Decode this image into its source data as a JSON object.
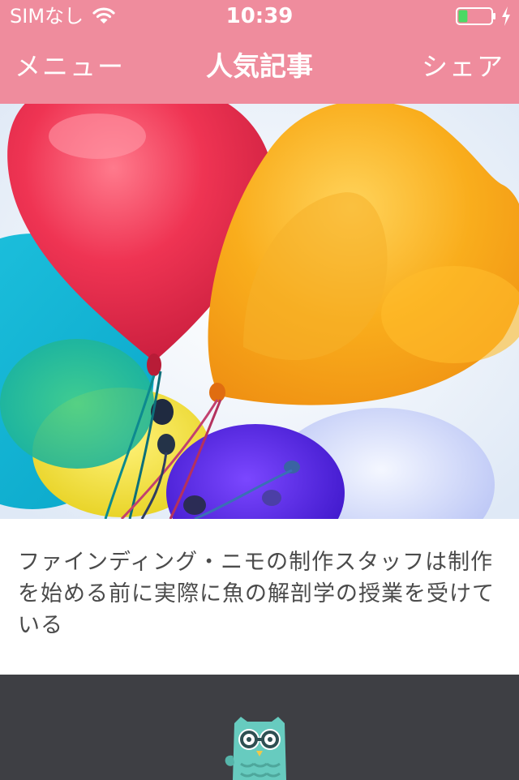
{
  "status_bar": {
    "carrier": "SIMなし",
    "time": "10:39",
    "battery_level": 0.28
  },
  "nav": {
    "menu_label": "メニュー",
    "title": "人気記事",
    "share_label": "シェア"
  },
  "article": {
    "title": "ファインディング・ニモの制作スタッフは制作を始める前に実際に魚の解剖学の授業を受けている"
  },
  "icons": {
    "wifi": "wifi-icon",
    "battery": "battery-icon",
    "charging": "charging-bolt-icon",
    "logo": "owl-logo"
  },
  "colors": {
    "header": "#ef8c9d",
    "footer": "#3e3f44",
    "battery_fill": "#4cd964",
    "owl": "#67cbbf"
  }
}
